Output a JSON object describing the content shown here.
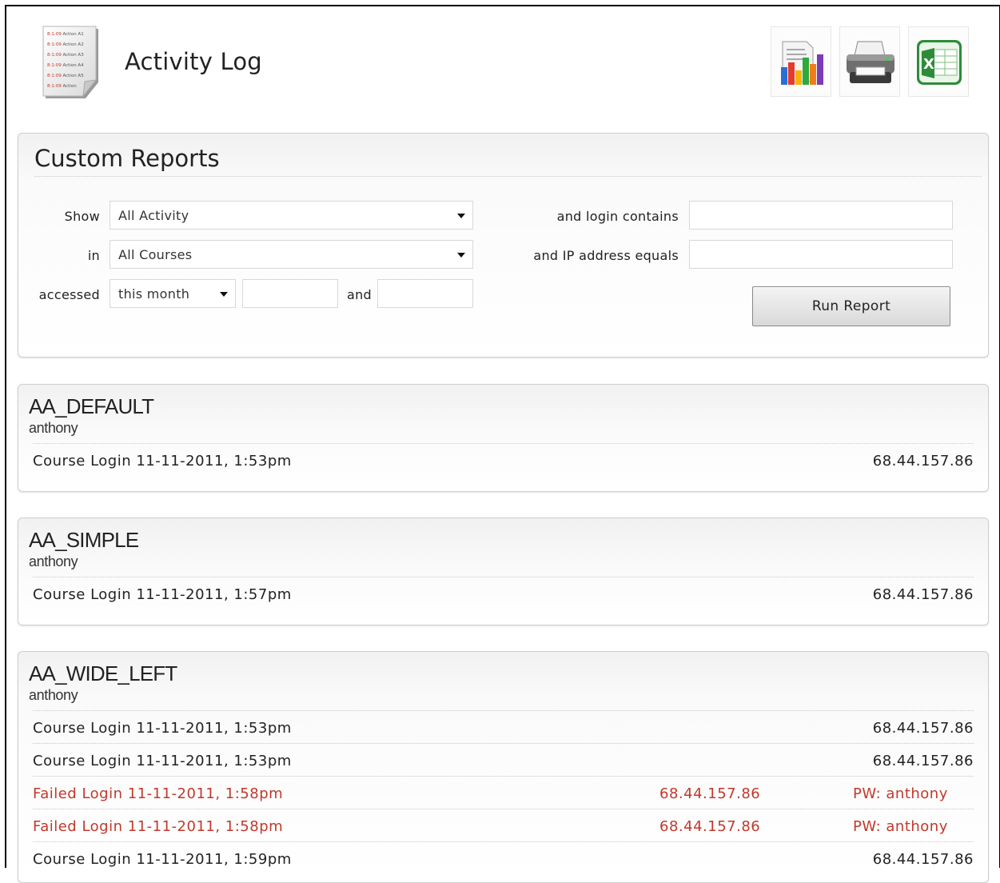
{
  "header": {
    "title": "Activity Log",
    "logo_lines": [
      "8:1:09 Action A1",
      "8:1:09 Action A2",
      "8:1:09 Action A3",
      "8:1:09 Action A4",
      "8:1:09 Action A5",
      "8:1:09 Action"
    ]
  },
  "toolbar": {
    "chart_icon": "chart-report-icon",
    "print_icon": "printer-icon",
    "excel_icon": "excel-icon"
  },
  "custom_reports": {
    "title": "Custom Reports",
    "show_label": "Show",
    "show_value": "All Activity",
    "in_label": "in",
    "in_value": "All Courses",
    "accessed_label": "accessed",
    "accessed_value": "this month",
    "from_date_value": "",
    "and_label": "and",
    "to_date_value": "",
    "login_label": "and login contains",
    "login_value": "",
    "ip_label": "and IP address equals",
    "ip_value": "",
    "run_button": "Run Report"
  },
  "courses": [
    {
      "name": "AA_DEFAULT",
      "user": "anthony",
      "entries": [
        {
          "text": "Course Login 11-11-2011, 1:53pm",
          "ip": "68.44.157.86"
        }
      ]
    },
    {
      "name": "AA_SIMPLE",
      "user": "anthony",
      "entries": [
        {
          "text": "Course Login 11-11-2011, 1:57pm",
          "ip": "68.44.157.86"
        }
      ]
    },
    {
      "name": "AA_WIDE_LEFT",
      "user": "anthony",
      "entries": [
        {
          "text": "Course Login 11-11-2011, 1:53pm",
          "ip": "68.44.157.86"
        },
        {
          "text": "Course Login 11-11-2011, 1:53pm",
          "ip": "68.44.157.86"
        },
        {
          "text": "Failed Login 11-11-2011, 1:58pm",
          "ip": "68.44.157.86",
          "pw": "PW: anthony"
        },
        {
          "text": "Failed Login 11-11-2011, 1:58pm",
          "ip": "68.44.157.86",
          "pw": "PW: anthony"
        },
        {
          "text": "Course Login 11-11-2011, 1:59pm",
          "ip": "68.44.157.86"
        }
      ]
    }
  ],
  "colors": {
    "failed": "#c0392b"
  }
}
